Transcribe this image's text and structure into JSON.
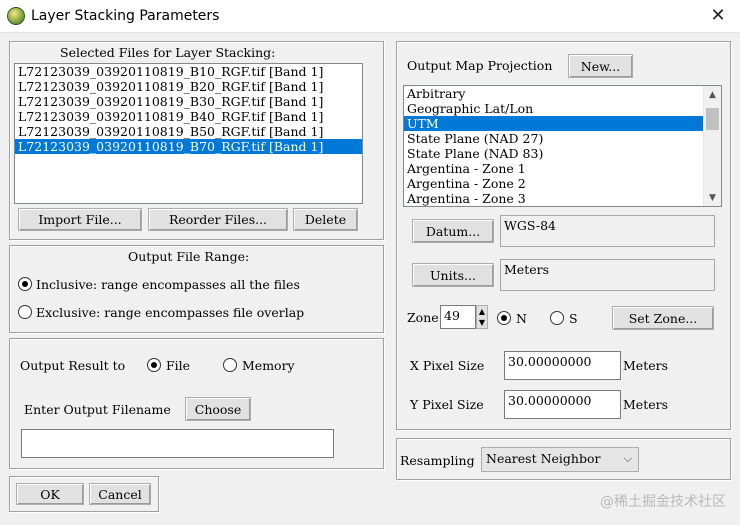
{
  "window": {
    "title": "Layer Stacking Parameters",
    "close_icon": "close-icon",
    "app_icon": "envi-globe-icon"
  },
  "selected_files": {
    "heading": "Selected Files for Layer Stacking:",
    "items": [
      "L72123039_03920110819_B10_RGF.tif [Band 1]",
      "L72123039_03920110819_B20_RGF.tif [Band 1]",
      "L72123039_03920110819_B30_RGF.tif [Band 1]",
      "L72123039_03920110819_B40_RGF.tif [Band 1]",
      "L72123039_03920110819_B50_RGF.tif [Band 1]",
      "L72123039_03920110819_B70_RGF.tif [Band 1]"
    ],
    "selected_index": 5,
    "buttons": {
      "import": "Import File...",
      "reorder": "Reorder Files...",
      "delete": "Delete"
    }
  },
  "output_range": {
    "heading": "Output File Range:",
    "inclusive": "Inclusive: range encompasses all the files",
    "exclusive": "Exclusive: range encompasses file overlap",
    "selected": "inclusive"
  },
  "output": {
    "result_label": "Output Result to",
    "file_label": "File",
    "memory_label": "Memory",
    "selected": "file",
    "filename_label": "Enter Output Filename",
    "choose_label": "Choose",
    "filename_value": ""
  },
  "dialog_buttons": {
    "ok": "OK",
    "cancel": "Cancel"
  },
  "projection": {
    "label": "Output Map Projection",
    "new_button": "New...",
    "items": [
      "Arbitrary",
      "Geographic Lat/Lon",
      "UTM",
      "State Plane (NAD 27)",
      "State Plane (NAD 83)",
      "Argentina - Zone 1",
      "Argentina - Zone 2",
      "Argentina - Zone 3"
    ],
    "selected_index": 2,
    "datum_button": "Datum...",
    "datum_value": "WGS-84",
    "units_button": "Units...",
    "units_value": "Meters",
    "zone_label": "Zone",
    "zone_value": "49",
    "n_label": "N",
    "s_label": "S",
    "hemisphere": "N",
    "set_zone_button": "Set Zone...",
    "x_pixel_label": "X Pixel Size",
    "x_pixel_value": "30.00000000",
    "x_pixel_units": "Meters",
    "y_pixel_label": "Y Pixel Size",
    "y_pixel_value": "30.00000000",
    "y_pixel_units": "Meters"
  },
  "resampling": {
    "label": "Resampling",
    "value": "Nearest Neighbor"
  },
  "watermark": "@稀土掘金技术社区"
}
